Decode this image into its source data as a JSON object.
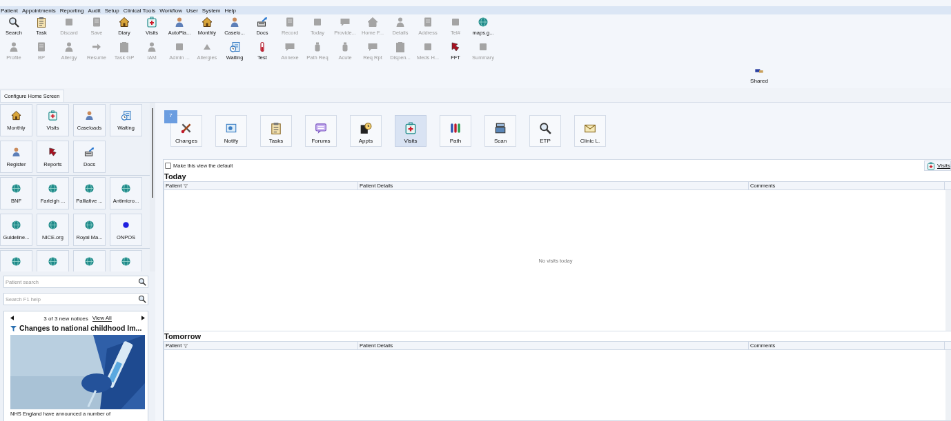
{
  "menu": [
    "Patient",
    "Appointments",
    "Reporting",
    "Audit",
    "Setup",
    "Clinical Tools",
    "Workflow",
    "User",
    "System",
    "Help"
  ],
  "toolbar": {
    "rows": [
      [
        {
          "label": "Search",
          "disabled": false
        },
        {
          "label": "Task",
          "disabled": false
        },
        {
          "label": "Discard",
          "disabled": true
        },
        {
          "label": "Save",
          "disabled": true
        },
        {
          "label": "Diary",
          "disabled": false
        },
        {
          "label": "Visits",
          "disabled": false
        },
        {
          "label": "AutoPla...",
          "disabled": false
        },
        {
          "label": "Monthly",
          "disabled": false
        },
        {
          "label": "Caselo...",
          "disabled": false
        },
        {
          "label": "Docs",
          "disabled": false
        },
        {
          "label": "Record",
          "disabled": true
        },
        {
          "label": "Today",
          "disabled": true
        },
        {
          "label": "Provide...",
          "disabled": true
        },
        {
          "label": "Home F...",
          "disabled": true
        },
        {
          "label": "Details",
          "disabled": true
        },
        {
          "label": "Address",
          "disabled": true
        },
        {
          "label": "Tel#",
          "disabled": true
        },
        {
          "label": "maps.g...",
          "disabled": false
        }
      ],
      [
        {
          "label": "Profile",
          "disabled": true
        },
        {
          "label": "BP",
          "disabled": true
        },
        {
          "label": "Allergy",
          "disabled": true
        },
        {
          "label": "Resume",
          "disabled": true
        },
        {
          "label": "Task GP",
          "disabled": true
        },
        {
          "label": "IAM",
          "disabled": true
        },
        {
          "label": "Admin ...",
          "disabled": true
        },
        {
          "label": "Allergies",
          "disabled": true
        },
        {
          "label": "Waiting",
          "disabled": false
        },
        {
          "label": "Test",
          "disabled": false
        },
        {
          "label": "Annexe",
          "disabled": true
        },
        {
          "label": "Path Req",
          "disabled": true
        },
        {
          "label": "Acute",
          "disabled": true
        },
        {
          "label": "Req Rpt",
          "disabled": true
        },
        {
          "label": "Dispen...",
          "disabled": true
        },
        {
          "label": "Meds H...",
          "disabled": true
        },
        {
          "label": "FFT",
          "disabled": false
        },
        {
          "label": "Summary",
          "disabled": true
        }
      ]
    ],
    "shared": {
      "label": "Shared",
      "disabled": false
    }
  },
  "configure_tab": "Configure Home Screen",
  "home_tiles": [
    [
      {
        "kind": "app",
        "label": "Monthly"
      },
      {
        "kind": "app",
        "label": "Visits"
      },
      {
        "kind": "app",
        "label": "Caseloads"
      },
      {
        "kind": "app",
        "label": "Waiting"
      },
      {
        "kind": "app",
        "label": "Register"
      },
      {
        "kind": "app",
        "label": "Reports"
      },
      {
        "kind": "app",
        "label": "Docs"
      }
    ],
    [
      {
        "kind": "url",
        "label": "BNF"
      },
      {
        "kind": "url",
        "label": "Farleigh ..."
      },
      {
        "kind": "url",
        "label": "Palliative ..."
      },
      {
        "kind": "url",
        "label": "Antimicro..."
      },
      {
        "kind": "url",
        "label": "Guideline..."
      },
      {
        "kind": "url",
        "label": "NICE.org"
      },
      {
        "kind": "url",
        "label": "Royal Ma..."
      },
      {
        "kind": "bullet",
        "label": "ONPOS"
      }
    ],
    [
      {
        "kind": "url"
      },
      {
        "kind": "url"
      },
      {
        "kind": "url"
      },
      {
        "kind": "url"
      }
    ]
  ],
  "patient_search": {
    "placeholder": "Patient search"
  },
  "help_search": {
    "placeholder": "Search F1 help"
  },
  "notices": {
    "counter": "3 of 3 new notices",
    "link": "View All",
    "title": "Changes to national childhood Im...",
    "body": "NHS England have announced a number of"
  },
  "quick_bar": {
    "badge": "7",
    "items": [
      {
        "label": "Changes",
        "selected": false
      },
      {
        "label": "Notify",
        "selected": false
      },
      {
        "label": "Tasks",
        "selected": false
      },
      {
        "label": "Forums",
        "selected": false
      },
      {
        "label": "Appts",
        "selected": false
      },
      {
        "label": "Visits",
        "selected": true
      },
      {
        "label": "Path",
        "selected": false
      },
      {
        "label": "Scan",
        "selected": false
      },
      {
        "label": "ETP",
        "selected": false
      },
      {
        "label": "Clinic L.",
        "selected": false
      }
    ]
  },
  "default_view": {
    "label": "Make this view the default",
    "checked": false
  },
  "visits_button": {
    "label": "Visits"
  },
  "sections": [
    {
      "title": "Today",
      "columns": [
        "Patient",
        "Patient Details",
        "Comments"
      ],
      "empty_text": "No visits today"
    },
    {
      "title": "Tomorrow",
      "columns": [
        "Patient",
        "Patient Details",
        "Comments"
      ]
    }
  ]
}
